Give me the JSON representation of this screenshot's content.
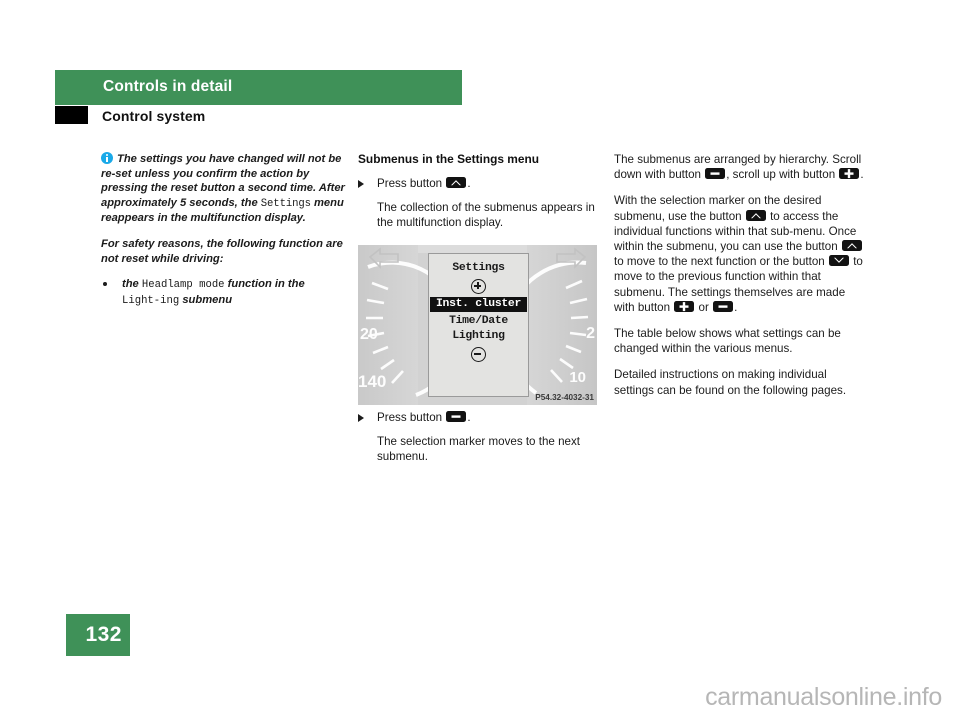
{
  "header": {
    "chapter_title": "Controls in detail",
    "section_title": "Control system",
    "band_color": "#3f9158"
  },
  "left_column": {
    "note": {
      "icon": "info-icon",
      "text_part1": "The settings you have changed will not be re-set unless you confirm the action by pressing the reset button a second time. After approximately 5 seconds, the ",
      "mono1": "Settings",
      "text_part2": " menu reappears in the multifunction display."
    },
    "safety_para": "For safety reasons, the following function are not reset while driving:",
    "bullet": {
      "lead": "the ",
      "mono1": "Headlamp mode",
      "mid": " function in the ",
      "mono2": "Light‑ing",
      "tail": " submenu"
    }
  },
  "middle_column": {
    "subheading": "Submenus in the Settings menu",
    "step1": {
      "lead": "Press button ",
      "icon": "up-chevron-key-icon",
      "tail": "."
    },
    "step1_result": "The collection of the submenus appears in the multifunction display.",
    "step2": {
      "lead": "Press button ",
      "icon": "minus-key-icon",
      "tail": "."
    },
    "step2_result": "The selection marker moves to the next submenu."
  },
  "cluster_figure": {
    "part_code": "P54.32-4032-31",
    "speedometer_labels": [
      "20",
      "140"
    ],
    "tachometer_labels": [
      "2",
      "10"
    ],
    "left_turn_indicator": "left-turn-arrow-icon",
    "right_turn_indicator": "right-turn-arrow-icon",
    "display": {
      "title": "Settings",
      "scroll_up_symbol": "plus-circle-icon",
      "items": [
        "Inst. cluster",
        "Time/Date",
        "Lighting"
      ],
      "selected_index": 0,
      "scroll_down_symbol": "minus-circle-icon"
    }
  },
  "right_column": {
    "para1": {
      "t1": "The submenus are arranged by hierarchy. Scroll down with button ",
      "icon1": "minus-key-icon",
      "t2": ", scroll up with button ",
      "icon2": "plus-key-icon",
      "t3": "."
    },
    "para2": {
      "t1": "With the selection marker on the desired submenu, use the button ",
      "icon1": "up-chevron-key-icon",
      "t2": " to access the individual functions within that sub-menu. Once within the submenu, you can use the button ",
      "icon2": "up-chevron-key-icon",
      "t3": " to move to the next function or the button ",
      "icon3": "down-chevron-key-icon",
      "t4": " to move to the previous function within that submenu. The settings themselves are made with button ",
      "icon4": "plus-key-icon",
      "t5": " or ",
      "icon5": "minus-key-icon",
      "t6": "."
    },
    "para3": "The table below shows what settings can be changed within the various menus.",
    "para4": "Detailed instructions on making individual settings can be found on the following pages."
  },
  "footer": {
    "page_number": "132",
    "watermark": "carmanualsonline.info"
  }
}
